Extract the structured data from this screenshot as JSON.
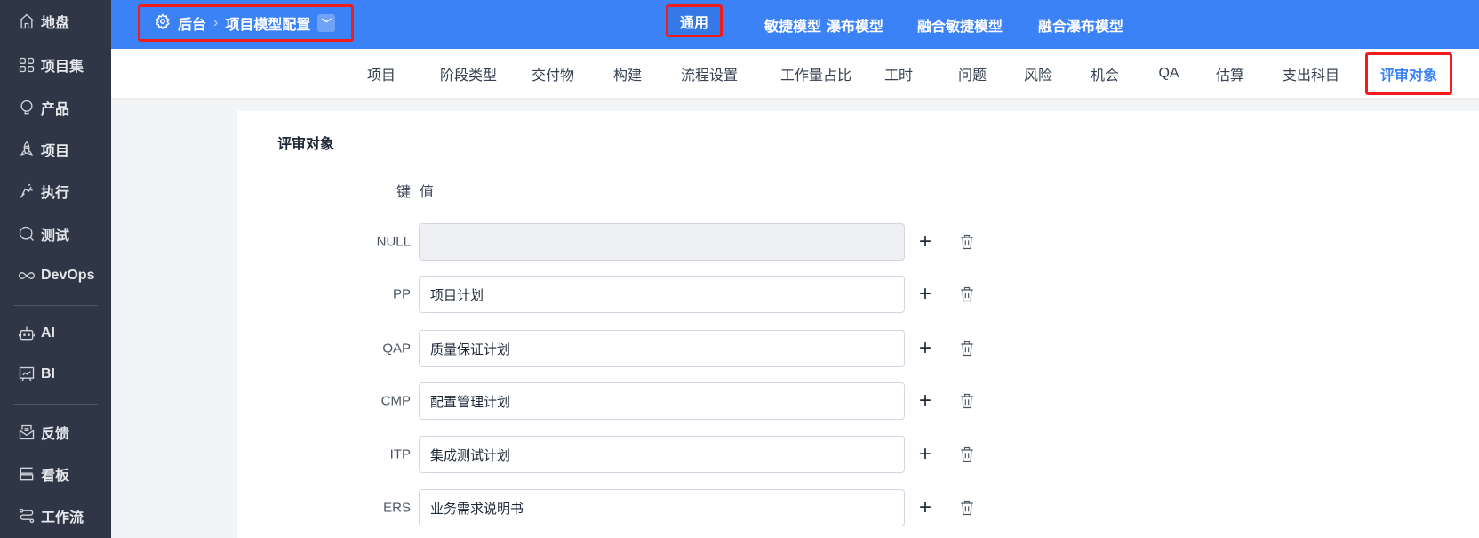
{
  "sidebar": {
    "items": [
      {
        "label": "地盘",
        "icon": "home-icon"
      },
      {
        "label": "项目集",
        "icon": "grid-icon"
      },
      {
        "label": "产品",
        "icon": "lightbulb-icon"
      },
      {
        "label": "项目",
        "icon": "rocket-icon"
      },
      {
        "label": "执行",
        "icon": "run-icon"
      },
      {
        "label": "测试",
        "icon": "search-icon"
      },
      {
        "label": "DevOps",
        "icon": "infinity-icon"
      },
      {
        "label": "AI",
        "icon": "robot-icon"
      },
      {
        "label": "BI",
        "icon": "chart-board-icon"
      },
      {
        "label": "反馈",
        "icon": "feedback-icon"
      },
      {
        "label": "看板",
        "icon": "kanban-icon"
      },
      {
        "label": "工作流",
        "icon": "workflow-icon"
      }
    ]
  },
  "breadcrumb": {
    "root": "后台",
    "current": "项目模型配置"
  },
  "top_tabs": [
    "通用",
    "敏捷模型",
    "瀑布模型",
    "融合敏捷模型",
    "融合瀑布模型"
  ],
  "sub_tabs": [
    "项目",
    "阶段类型",
    "交付物",
    "构建",
    "流程设置",
    "工作量占比",
    "工时",
    "问题",
    "风险",
    "机会",
    "QA",
    "估算",
    "支出科目",
    "评审对象"
  ],
  "section": {
    "title": "评审对象",
    "key_header": "键",
    "value_header": "值",
    "rows": [
      {
        "key": "NULL",
        "value": ""
      },
      {
        "key": "PP",
        "value": "项目计划"
      },
      {
        "key": "QAP",
        "value": "质量保证计划"
      },
      {
        "key": "CMP",
        "value": "配置管理计划"
      },
      {
        "key": "ITP",
        "value": "集成测试计划"
      },
      {
        "key": "ERS",
        "value": "业务需求说明书"
      }
    ]
  },
  "colors": {
    "primary": "#3b82f6",
    "sidebar": "#2f3747",
    "highlight": "#f01c1c"
  }
}
